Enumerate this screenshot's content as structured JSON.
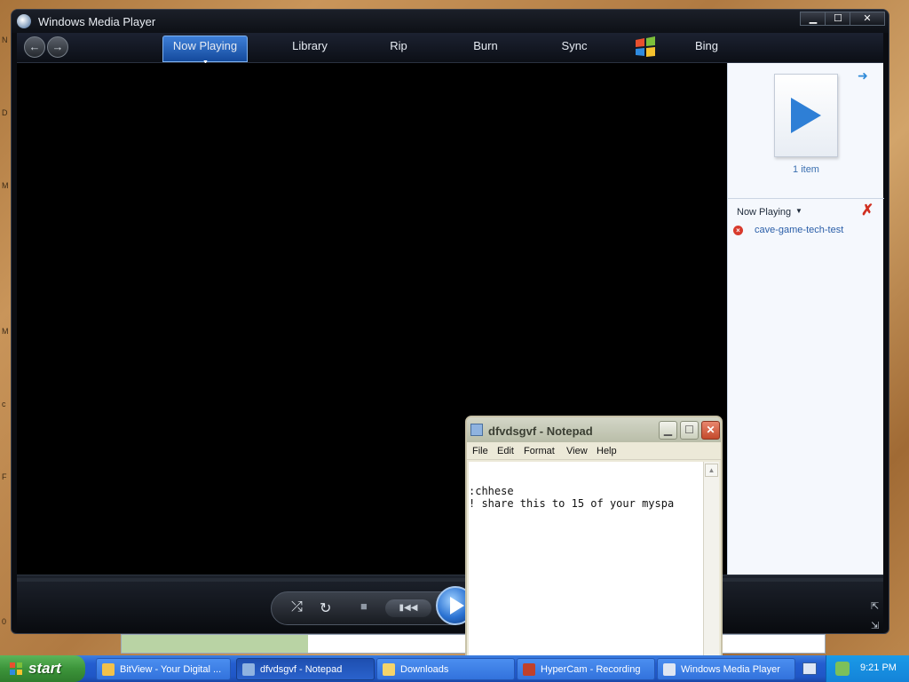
{
  "desktop": {
    "edge_letters": [
      "N",
      "D",
      "M",
      "M",
      "c",
      "F",
      "0"
    ]
  },
  "wmp": {
    "title": "Windows Media Player",
    "controls": {
      "minimize": "▁",
      "maximize": "☐",
      "close": "✕"
    },
    "nav_back": "←",
    "nav_forward": "→",
    "tabs": [
      "Now Playing",
      "Library",
      "Rip",
      "Burn",
      "Sync",
      "Bing"
    ],
    "list_pane": {
      "item_count": "1 item",
      "now_playing_label": "Now Playing",
      "tracks": [
        "cave-game-tech-test"
      ]
    }
  },
  "notepad": {
    "title": "dfvdsgvf - Notepad",
    "menu": [
      "File",
      "Edit",
      "Format",
      "View",
      "Help"
    ],
    "lines": [
      ":chhese",
      "! share this to 15 of your myspa"
    ]
  },
  "taskbar": {
    "start_label": "start",
    "tasks": [
      {
        "label": "BitView - Your Digital ...",
        "icon_color": "#f2c14a"
      },
      {
        "label": "dfvdsgvf - Notepad",
        "icon_color": "#8fb3e0"
      },
      {
        "label": "Downloads",
        "icon_color": "#f4d46a"
      },
      {
        "label": "HyperCam - Recording",
        "icon_color": "#c0402a"
      },
      {
        "label": "Windows Media Player",
        "icon_color": "#dfe6f2"
      }
    ],
    "active_task_index": 1,
    "clock": "9:21 PM"
  }
}
